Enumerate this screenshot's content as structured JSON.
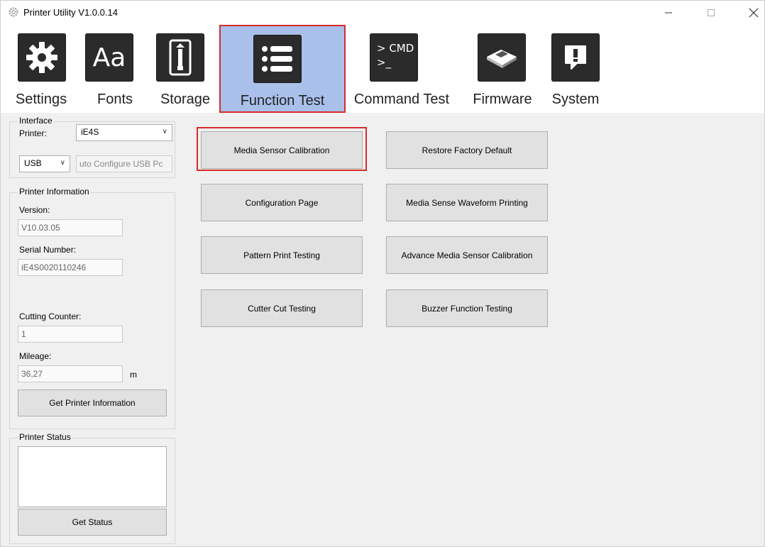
{
  "window": {
    "title": "Printer Utility  V1.0.0.14",
    "controls": {
      "minimize": "—",
      "maximize": "☐",
      "close": "✕"
    }
  },
  "toolbar": {
    "items": [
      {
        "label": "Settings",
        "icon": "gear-icon"
      },
      {
        "label": "Fonts",
        "icon": "font-icon",
        "glyph": "Aa"
      },
      {
        "label": "Storage",
        "icon": "storage-icon"
      },
      {
        "label": "Function Test",
        "icon": "list-icon",
        "active": true
      },
      {
        "label": "Command Test",
        "icon": "cmd-icon",
        "glyph_line1": "> CMD",
        "glyph_line2": ">_"
      },
      {
        "label": "Firmware",
        "icon": "chip-icon"
      },
      {
        "label": "System",
        "icon": "alert-icon"
      }
    ]
  },
  "interface": {
    "title": "Interface",
    "printer_label": "Printer:",
    "printer_value": "iE4S",
    "port_value": "USB",
    "auto_config": "uto Configure USB Pc"
  },
  "printer_info": {
    "title": "Printer Information",
    "version_label": "Version:",
    "version_value": "V10.03.05",
    "serial_label": "Serial Number:",
    "serial_value": "iE4S0020110246",
    "cutting_label": "Cutting Counter:",
    "cutting_value": "1",
    "mileage_label": "Mileage:",
    "mileage_value": "36,27",
    "mileage_unit": "m",
    "get_info_button": "Get Printer Information"
  },
  "printer_status": {
    "title": "Printer Status",
    "get_status_button": "Get Status"
  },
  "function_buttons": [
    "Media Sensor Calibration",
    "Restore Factory Default",
    "Configuration Page",
    "Media Sense Waveform Printing",
    "Pattern Print Testing",
    "Advance Media Sensor Calibration",
    "Cutter Cut Testing",
    "Buzzer Function Testing"
  ],
  "colors": {
    "highlight": "#d62c2c",
    "active_tab": "#a9c0ea",
    "icon_bg": "#2b2b2b"
  }
}
